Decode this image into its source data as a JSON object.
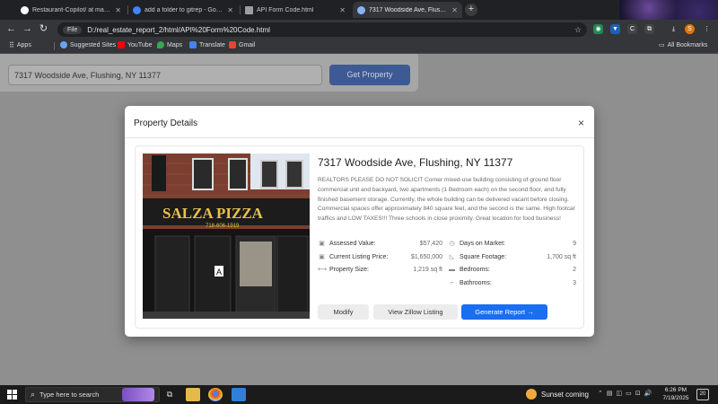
{
  "browser": {
    "tabs": [
      {
        "title": "Restaurant-Copilot/ at main · ",
        "favicon_color": "#ffffff"
      },
      {
        "title": "add a folder to gitrep - Google",
        "favicon_color": "#4285f4"
      },
      {
        "title": "API Form Code.html",
        "favicon_color": "#9e9e9e"
      },
      {
        "title": "7317 Woodside Ave, Flushing, ",
        "favicon_color": "#8ab4f8"
      }
    ],
    "address_chip": "File",
    "url": "D:/real_estate_report_2/html/API%20Form%20Code.html",
    "profile_initial": "S",
    "bookmarks": [
      "Apps",
      "Suggested Sites",
      "YouTube",
      "Maps",
      "Translate",
      "Gmail"
    ],
    "all_bookmarks": "All Bookmarks"
  },
  "search": {
    "value": "7317 Woodside Ave, Flushing, NY 11377",
    "button_label": "Get Property"
  },
  "modal": {
    "title": "Property Details",
    "close_symbol": "×",
    "photo_sign": "SALZA PIZZA",
    "photo_phone": "718-606-1919",
    "photo_letter": "A",
    "address": "7317 Woodside Ave, Flushing, NY 11377",
    "description": "REALTORS PLEASE DO NOT SOLICIT Corner mixed-use building consisting of ground floor commercial unit and backyard, two apartments (1 Bedroom each) on the second floor, and fully finished basement storage. Currently, the whole building can be delivered vacant before closing. Commercial spaces offer approximately 840 square feet, and the second is the same. High footcar traffics and LOW TAXES!!! Three schools in close proximity. Great location for food business!",
    "stats_left": [
      {
        "label": "Assessed Value:",
        "value": "$57,420",
        "icon": "dollar-icon"
      },
      {
        "label": "Current Listing Price:",
        "value": "$1,650,000",
        "icon": "tag-icon"
      },
      {
        "label": "Property Size:",
        "value": "1,219 sq ft",
        "icon": "arrows-icon"
      }
    ],
    "stats_right": [
      {
        "label": "Days on Market:",
        "value": "9",
        "icon": "clock-icon"
      },
      {
        "label": "Square Footage:",
        "value": "1,700 sq ft",
        "icon": "ruler-icon"
      },
      {
        "label": "Bedrooms:",
        "value": "2",
        "icon": "bed-icon"
      },
      {
        "label": "Bathrooms:",
        "value": "3",
        "icon": "bath-icon"
      }
    ],
    "buttons": {
      "modify": "Modify",
      "zillow": "View Zillow Listing",
      "report": "Generate Report →"
    }
  },
  "taskbar": {
    "search_placeholder": "Type here to search",
    "weather": "Sunset coming",
    "time": "6:26 PM",
    "date": "7/19/2025",
    "notification_count": "20"
  },
  "colors": {
    "primary_button": "#1a6ef2",
    "dim_overlay": "#8f8f8f"
  }
}
